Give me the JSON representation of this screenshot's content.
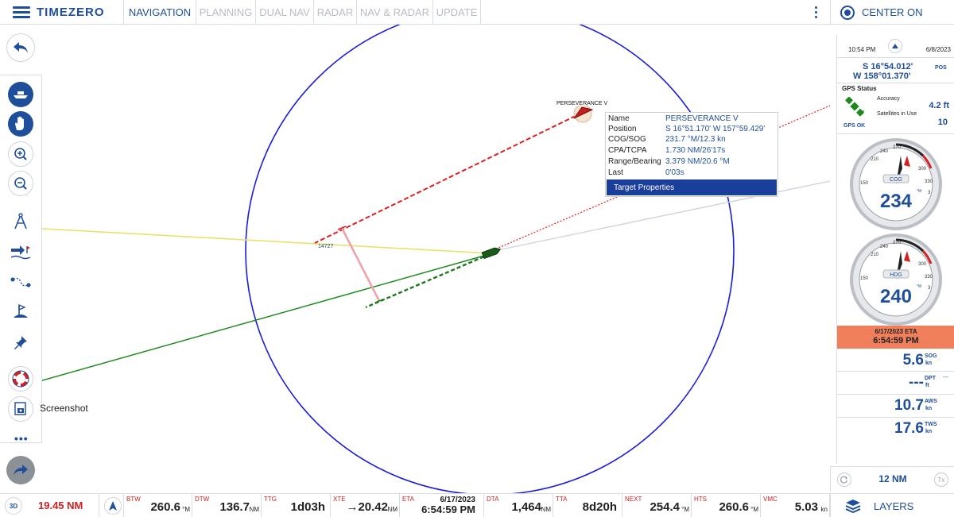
{
  "app": {
    "brand": "TIMEZERO"
  },
  "tabs": [
    {
      "label": "NAVIGATION",
      "active": true
    },
    {
      "label": "PLANNING",
      "active": false
    },
    {
      "label": "DUAL NAV",
      "active": false
    },
    {
      "label": "RADAR",
      "active": false
    },
    {
      "label": "NAV & RADAR",
      "active": false
    },
    {
      "label": "UPDATE",
      "active": false
    }
  ],
  "header": {
    "center_on": "CENTER ON"
  },
  "left_tools": {
    "screenshot_label": "Screenshot",
    "more": "•••"
  },
  "chart": {
    "target_label": "PERSEVERANCE V",
    "waypoint_label": "14727"
  },
  "target_popup": {
    "rows": [
      {
        "key": "Name",
        "value": "PERSEVERANCE V"
      },
      {
        "key": "Position",
        "value": "S 16°51.170' W 157°59.429'"
      },
      {
        "key": "COG/SOG",
        "value": "231.7 °M/12.3 kn"
      },
      {
        "key": "CPA/TCPA",
        "value": "1.730 NM/26'17s"
      },
      {
        "key": "Range/Bearing",
        "value": "3.379 NM/20.6 °M"
      },
      {
        "key": "Last",
        "value": "0'03s"
      }
    ],
    "button": "Target Properties"
  },
  "right_panel": {
    "time": "10:54 PM",
    "date": "6/8/2023",
    "lat": "S 16°54.012'",
    "lon": "W 158°01.370'",
    "pos_label": "POS",
    "gps": {
      "title": "GPS Status",
      "accuracy_label": "Accuracy",
      "accuracy_value": "4.2 ft",
      "satellites_label": "Satellites in Use",
      "satellites_value": "10",
      "status": "GPS OK"
    },
    "cog": {
      "label": "COG",
      "value": "234",
      "unit": "°M",
      "ticks": [
        "150",
        "210",
        "240",
        "270",
        "300",
        "330",
        "3"
      ]
    },
    "hdg": {
      "label": "HDG",
      "value": "240",
      "unit": "°M",
      "ticks": [
        "150",
        "210",
        "240",
        "270",
        "300",
        "330",
        "3"
      ]
    },
    "eta": {
      "date": "6/17/2023 ETA",
      "time": "6:54:59 PM"
    },
    "sog": {
      "value": "5.6",
      "label": "SOG",
      "unit": "kn"
    },
    "dpt": {
      "value": "---",
      "label": "DPT",
      "unit": "ft",
      "extra": "---"
    },
    "aws": {
      "value": "10.7",
      "label": "AWS",
      "unit": "kn"
    },
    "tws": {
      "value": "17.6",
      "label": "TWS",
      "unit": "kn"
    },
    "range": {
      "value": "12 NM",
      "tx": "Tx"
    }
  },
  "bottom_bar": {
    "view_3d": "3D",
    "distance": "19.45 NM",
    "cells": [
      {
        "label": "BTW",
        "value": "260.6",
        "unit": "°M"
      },
      {
        "label": "DTW",
        "value": "136.7",
        "unit": "NM"
      },
      {
        "label": "TTG",
        "value": "1d03h",
        "unit": ""
      },
      {
        "label": "XTE",
        "value": "→20.42",
        "unit": "NM"
      },
      {
        "label": "ETA",
        "date": "6/17/2023",
        "time": "6:54:59 PM"
      },
      {
        "label": "DTA",
        "value": "1,464",
        "unit": "NM"
      },
      {
        "label": "TTA",
        "value": "8d20h",
        "unit": ""
      },
      {
        "label": "NEXT",
        "value": "254.4",
        "unit": "°M"
      },
      {
        "label": "HTS",
        "value": "260.6",
        "unit": "°M"
      },
      {
        "label": "VMC",
        "value": "5.03",
        "unit": "kn"
      }
    ],
    "layers": "LAYERS"
  },
  "colors": {
    "accent": "#1f4e9b",
    "eta_bg": "#f07f5c",
    "alert": "#d42020",
    "range_ring": "#1a1ae0"
  }
}
